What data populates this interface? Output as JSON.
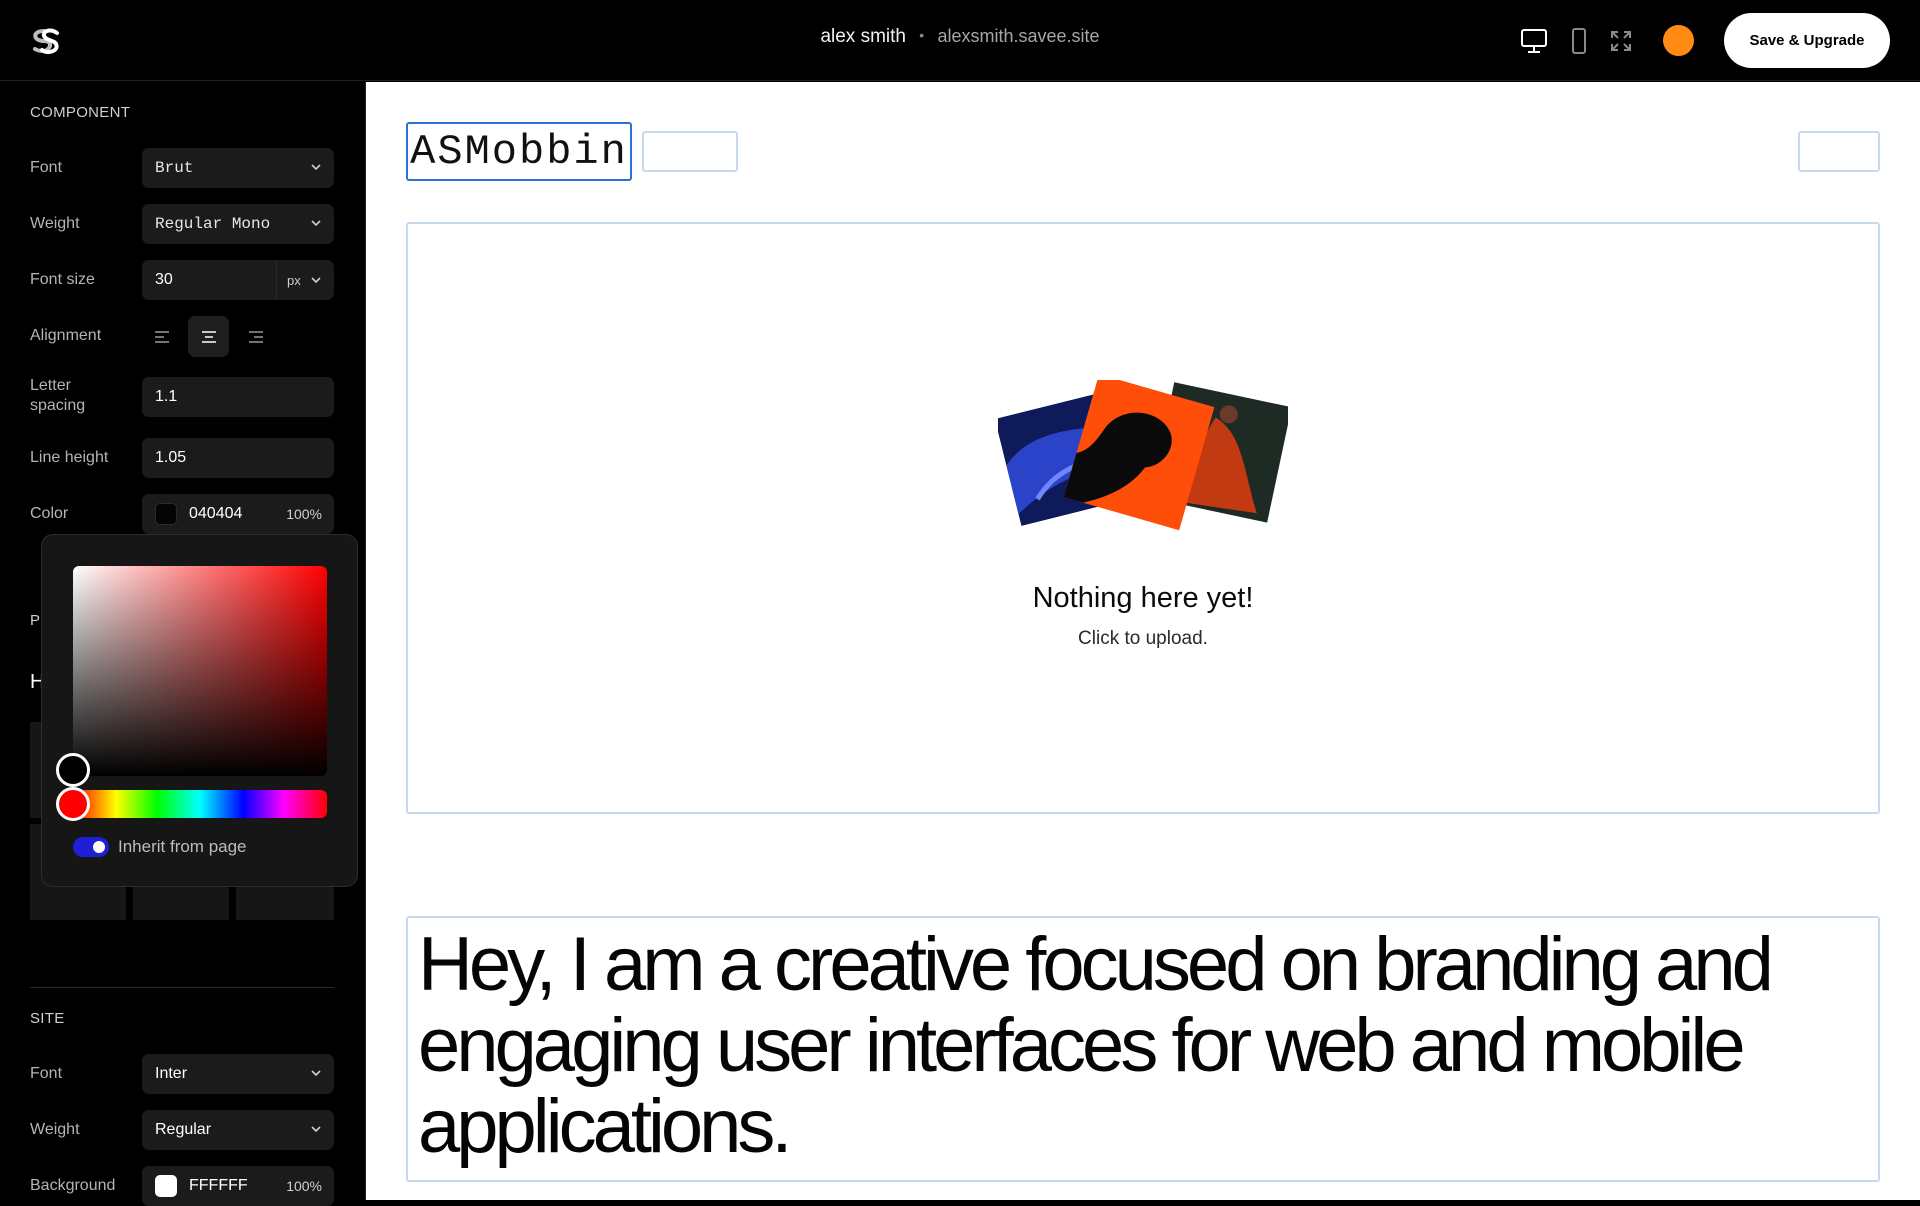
{
  "topbar": {
    "user_name": "alex smith",
    "separator": "•",
    "site_url": "alexsmith.savee.site",
    "upgrade_label": "Save & Upgrade",
    "avatar_color": "#ff8a14",
    "icons": [
      "desktop-view-icon",
      "mobile-view-icon",
      "fullscreen-icon"
    ]
  },
  "component": {
    "title": "COMPONENT",
    "font_label": "Font",
    "font_value": "Brut",
    "weight_label": "Weight",
    "weight_value": "Regular Mono",
    "size_label": "Font size",
    "size_value": "30",
    "size_unit": "px",
    "alignment_label": "Alignment",
    "alignment_selected": "center",
    "letter_label_1": "Letter",
    "letter_label_2": "spacing",
    "letter_value": "1.1",
    "line_label": "Line height",
    "line_value": "1.05",
    "color_label": "Color",
    "color_value": "040404",
    "color_swatch": "#040404",
    "color_opacity": "100%"
  },
  "picker": {
    "hue_color": "#ff0000",
    "selected_color": "#000000",
    "inherit_label": "Inherit from page",
    "inherit_on": true
  },
  "hidden_section": {
    "partial_title": "P",
    "partial_label": "H"
  },
  "site": {
    "title": "SITE",
    "font_label": "Font",
    "font_value": "Inter",
    "weight_label": "Weight",
    "weight_value": "Regular",
    "bg_label": "Background",
    "bg_value": "FFFFFF",
    "bg_swatch": "#ffffff",
    "bg_opacity": "100%"
  },
  "canvas": {
    "site_title": "ASMobbin",
    "empty_title": "Nothing here yet!",
    "empty_subtitle": "Click to upload.",
    "bio": "Hey, I am a creative focused on branding and engaging user interfaces for web and mobile applications."
  }
}
